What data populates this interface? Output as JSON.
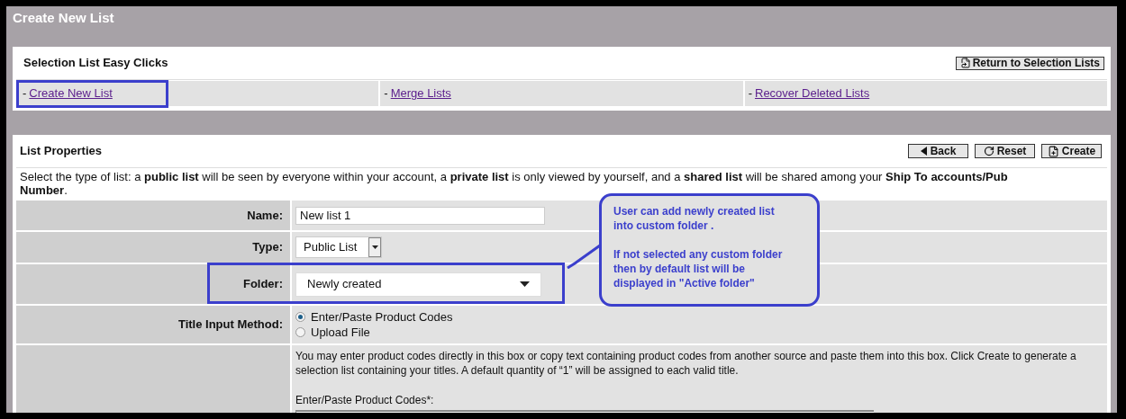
{
  "page_title": "Create New List",
  "easy_clicks": {
    "title": "Selection List Easy Clicks",
    "return_button": "Return to Selection Lists",
    "links": [
      {
        "prefix": "-",
        "label": "Create New List",
        "highlighted": true
      },
      {
        "prefix": "-",
        "label": "Merge Lists",
        "highlighted": false
      },
      {
        "prefix": "-",
        "label": "Recover Deleted Lists",
        "highlighted": false
      }
    ]
  },
  "list_properties": {
    "title": "List Properties",
    "buttons": [
      {
        "kind": "back",
        "label": "Back"
      },
      {
        "kind": "reset",
        "label": "Reset"
      },
      {
        "kind": "create",
        "label": "Create"
      }
    ],
    "intro": "Select the type of list: a **public list** will be seen by everyone within your account, a **private list** is only viewed by yourself, and a **shared list** will be shared among your **Ship To accounts/Pub Number**.",
    "fields": [
      {
        "kind": "text",
        "label": "Name:",
        "value": "New list 1"
      },
      {
        "kind": "select",
        "label": "Type:",
        "value": "Public List"
      },
      {
        "kind": "dropdown",
        "label": "Folder:",
        "value": "Newly created",
        "highlighted": true
      },
      {
        "kind": "radio",
        "label": "Title Input Method:",
        "options": [
          {
            "label": "Enter/Paste Product Codes",
            "selected": true
          },
          {
            "label": "Upload File",
            "selected": false
          }
        ]
      },
      {
        "kind": "codes",
        "help": "You may enter product codes directly in this box or copy text containing product codes from another source and paste them into this box. Click Create to generate a selection list containing your titles. A default quantity of “1” will be assigned to each valid title.",
        "field_label": "Enter/Paste Product Codes*:"
      }
    ]
  },
  "callout": {
    "paragraphs": [
      [
        "User can add newly created list",
        "into custom folder ."
      ],
      [
        "If not selected any custom folder",
        "then by default list will be",
        "displayed in \"Active folder\""
      ]
    ]
  }
}
